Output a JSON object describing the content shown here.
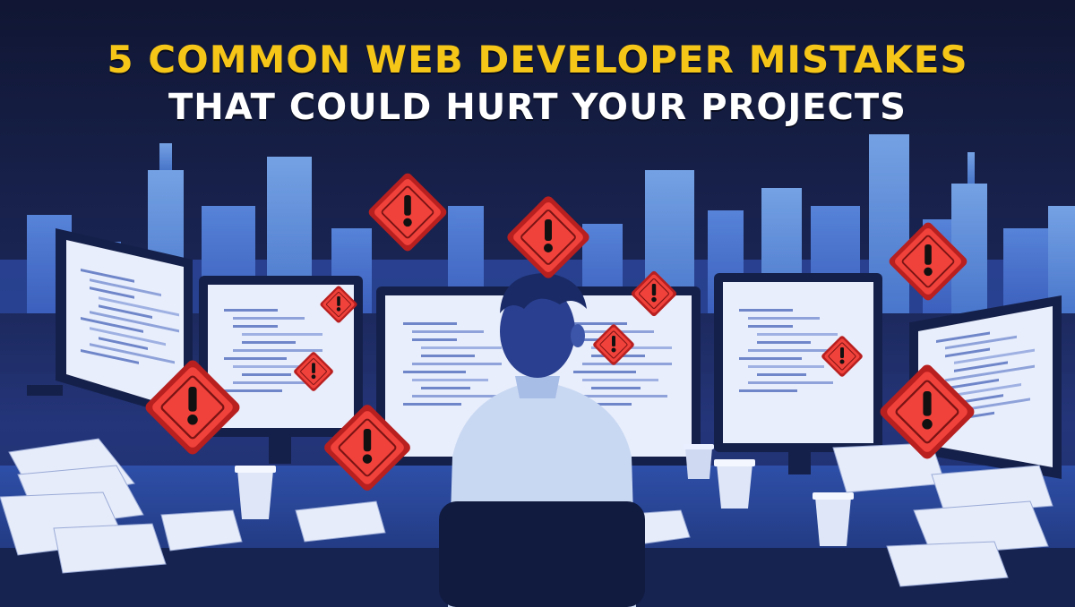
{
  "headline": {
    "line1": "5 COMMON WEB DEVELOPER MISTAKES",
    "line2": "THAT COULD HURT YOUR PROJECTS"
  },
  "colors": {
    "headline_primary": "#f5c518",
    "headline_secondary": "#ffffff",
    "warning_fill": "#f1413b",
    "warning_border": "#b81f1f",
    "warning_glyph": "#111111",
    "screen_glow": "#e8eefc",
    "night_sky": "#141b3a"
  },
  "icons": [
    "warning-sign-icon",
    "exclamation-icon",
    "coffee-cup-icon",
    "paper-stack-icon"
  ]
}
